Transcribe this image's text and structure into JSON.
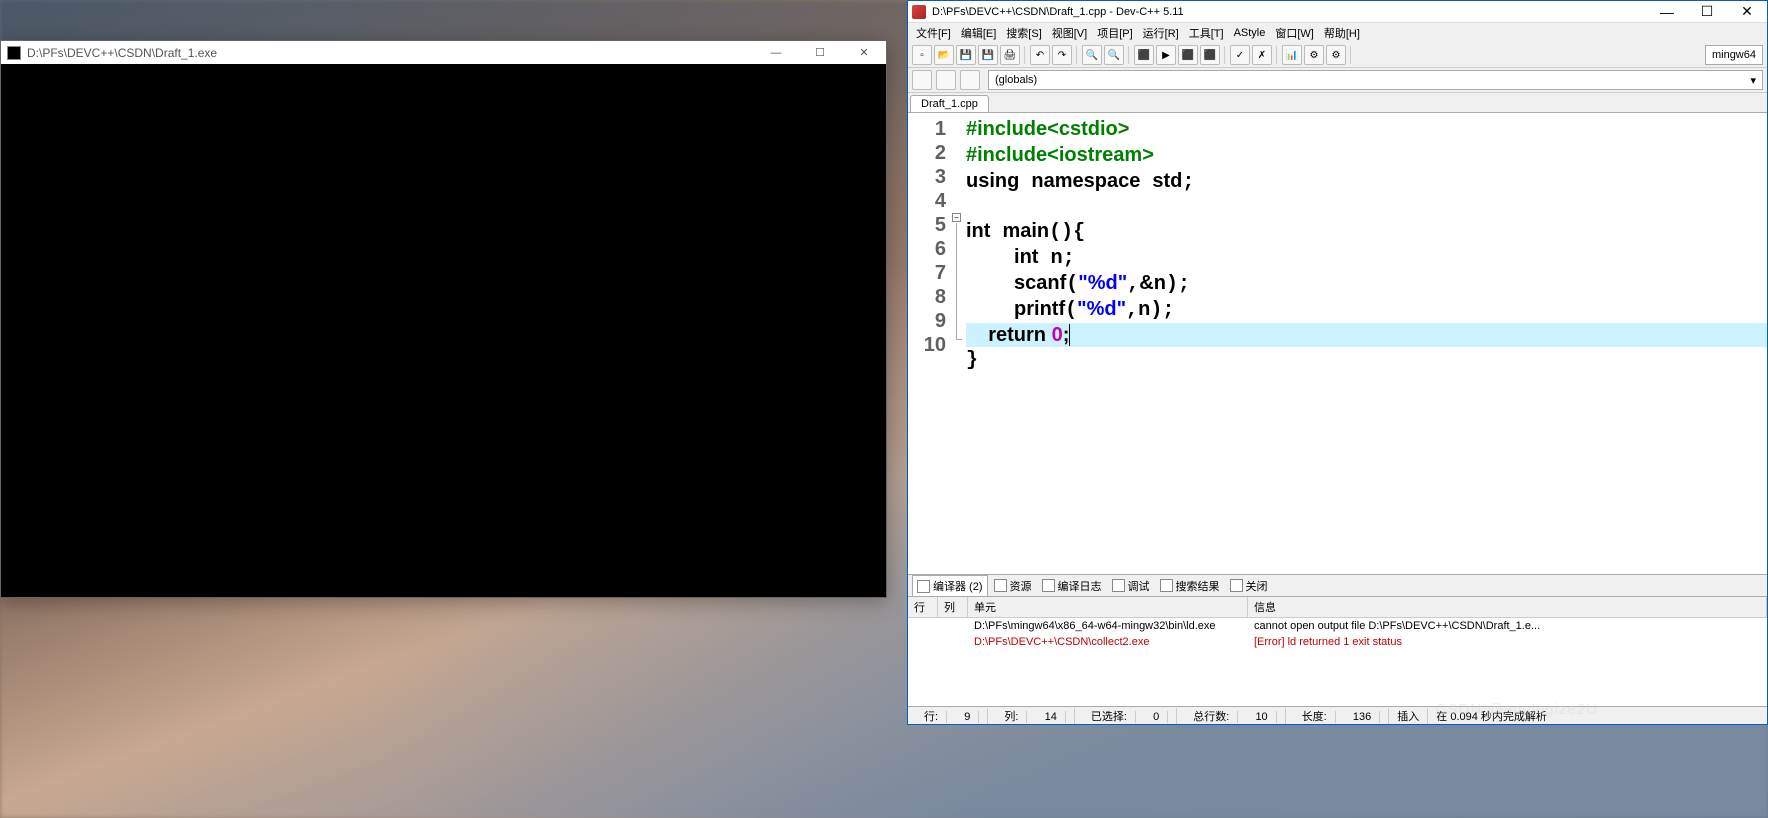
{
  "console": {
    "title": "D:\\PFs\\DEVC++\\CSDN\\Draft_1.exe"
  },
  "devcpp": {
    "title": "D:\\PFs\\DEVC++\\CSDN\\Draft_1.cpp - Dev-C++ 5.11",
    "menu": [
      "文件[F]",
      "编辑[E]",
      "搜索[S]",
      "视图[V]",
      "项目[P]",
      "运行[R]",
      "工具[T]",
      "AStyle",
      "窗口[W]",
      "帮助[H]"
    ],
    "compiler_selector": "mingw64",
    "globals": "(globals)",
    "tab": "Draft_1.cpp",
    "code_lines": 10,
    "highlighted_line": 9,
    "code": {
      "l1_pp": "#include",
      "l1_hdr": "<cstdio>",
      "l2_pp": "#include",
      "l2_hdr": "<iostream>",
      "l3": "using namespace std;",
      "l3_kw1": "using",
      "l3_kw2": "namespace",
      "l3_id": "std",
      "l5_kw": "int",
      "l5_fn": "main",
      "l6_kw": "int",
      "l6_id": "n",
      "l7_fn": "scanf",
      "l7_str": "\"%d\"",
      "l7_arg": "&n",
      "l8_fn": "printf",
      "l8_str": "\"%d\"",
      "l8_arg": "n",
      "l9_kw": "return",
      "l9_num": "0"
    },
    "bottom_tabs": {
      "compiler": "编译器 (2)",
      "resources": "资源",
      "compile_log": "编译日志",
      "debug": "调试",
      "search": "搜索结果",
      "close": "关闭"
    },
    "error_columns": {
      "row": "行",
      "col": "列",
      "unit": "单元",
      "info": "信息"
    },
    "errors": [
      {
        "row": "",
        "col": "",
        "unit": "D:\\PFs\\mingw64\\x86_64-w64-mingw32\\bin\\ld.exe",
        "info": "cannot open output file D:\\PFs\\DEVC++\\CSDN\\Draft_1.e...",
        "red": false
      },
      {
        "row": "",
        "col": "",
        "unit": "D:\\PFs\\DEVC++\\CSDN\\collect2.exe",
        "info": "[Error] ld returned 1 exit status",
        "red": true
      }
    ],
    "status": {
      "row_label": "行:",
      "row": "9",
      "col_label": "列:",
      "col": "14",
      "sel_label": "已选择:",
      "sel": "0",
      "total_label": "总行数:",
      "total": "10",
      "len_label": "长度:",
      "len": "136",
      "mode": "插入",
      "timing": "在 0.094 秒内完成解析"
    }
  },
  "watermark": "CSDN @apologize2U"
}
